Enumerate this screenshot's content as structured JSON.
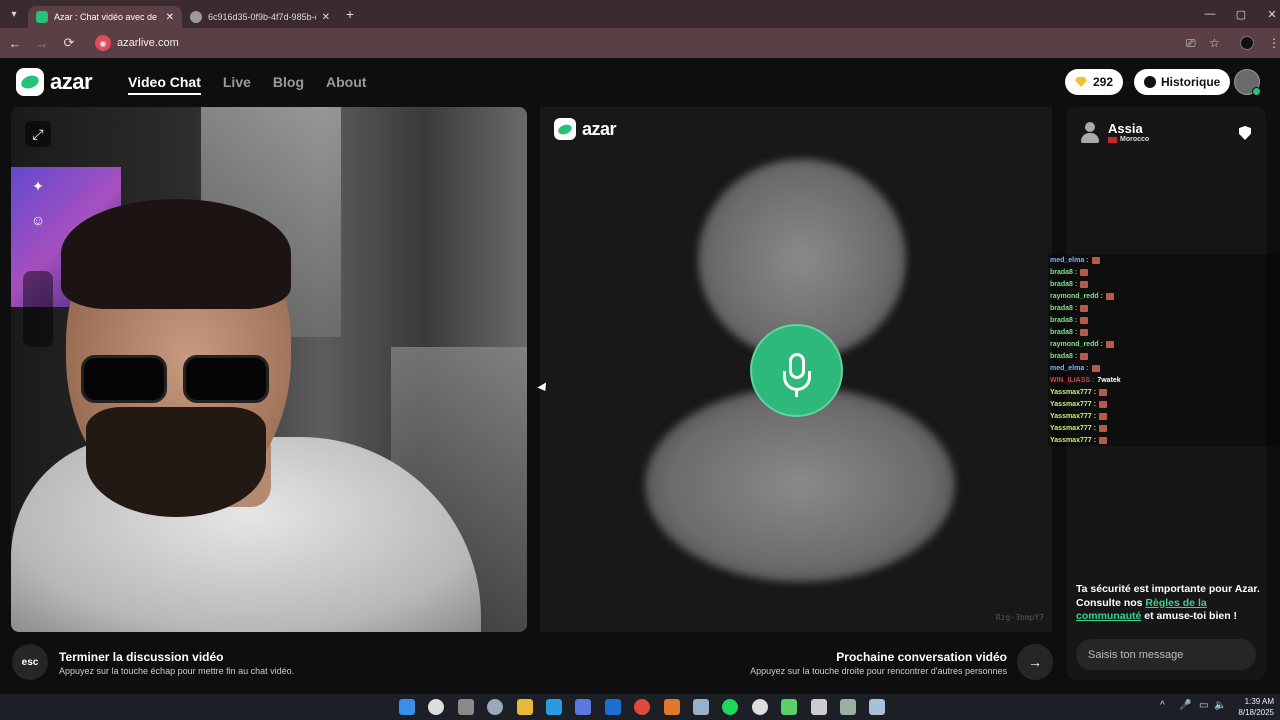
{
  "browser": {
    "tabs": [
      {
        "title": "Azar : Chat vidéo avec de n",
        "active": true,
        "favicon_color": "#27c27a"
      },
      {
        "title": "6c916d35-0f9b-4f7d-985b-c4b",
        "active": false,
        "favicon_color": "#9a9a9a"
      }
    ],
    "url": "azarlive.com",
    "icons": {
      "tab_search": "chevron-down-icon",
      "new_tab": "+",
      "back": "←",
      "forward": "→",
      "reload": "⟳",
      "minimize": "—",
      "maximize": "▢",
      "close": "✕",
      "tab_close": "✕"
    }
  },
  "site": {
    "logo_text": "azar",
    "nav": [
      {
        "label": "Video Chat",
        "active": true
      },
      {
        "label": "Live",
        "active": false
      },
      {
        "label": "Blog",
        "active": false
      },
      {
        "label": "About",
        "active": false
      }
    ],
    "gems": "292",
    "history_label": "Historique",
    "accent": "#27c27a"
  },
  "partner": {
    "logo_text": "azar",
    "name": "Assia",
    "country": "Morocco",
    "id": "Rzg-3bmpY7"
  },
  "feed": [
    {
      "user": "med_elma :",
      "color": "#7fb0ff",
      "text": ""
    },
    {
      "user": "brada8 :",
      "color": "#7fe08a",
      "text": ""
    },
    {
      "user": "brada8 :",
      "color": "#7fe08a",
      "text": ""
    },
    {
      "user": "raymond_redd :",
      "color": "#7fe08a",
      "text": ""
    },
    {
      "user": "brada8 :",
      "color": "#7fe08a",
      "text": ""
    },
    {
      "user": "brada8 :",
      "color": "#7fe08a",
      "text": ""
    },
    {
      "user": "brada8 :",
      "color": "#7fe08a",
      "text": ""
    },
    {
      "user": "raymond_redd :",
      "color": "#7fe08a",
      "text": ""
    },
    {
      "user": "brada8 :",
      "color": "#7fe08a",
      "text": ""
    },
    {
      "user": "med_elma :",
      "color": "#7fb0ff",
      "text": ""
    },
    {
      "user": "WIN_ILIASS :",
      "color": "#e04040",
      "text": "7watek"
    },
    {
      "user": "Yassmax777 :",
      "color": "#c6f07a",
      "text": ""
    },
    {
      "user": "Yassmax777 :",
      "color": "#c6f07a",
      "text": ""
    },
    {
      "user": "Yassmax777 :",
      "color": "#c6f07a",
      "text": ""
    },
    {
      "user": "Yassmax777 :",
      "color": "#c6f07a",
      "text": ""
    },
    {
      "user": "Yassmax777 :",
      "color": "#c6f07a",
      "text": ""
    }
  ],
  "safety": {
    "before": "Ta sécurité est importante pour Azar. Consulte nos ",
    "link": "Règles de la communauté",
    "after": " et amuse-toi bien !"
  },
  "chat_input": {
    "placeholder": "Saisis ton message"
  },
  "controls": {
    "end": {
      "key": "esc",
      "title": "Terminer la discussion vidéo",
      "sub": "Appuyez sur la touche échap pour mettre fin au chat vidéo."
    },
    "next": {
      "key": "→",
      "title": "Prochaine conversation vidéo",
      "sub": "Appuyez sur la touche droite pour rencontrer d'autres personnes"
    }
  },
  "taskbar": {
    "time": "1:39 AM",
    "date": "8/18/2025",
    "apps": [
      "windows-start-icon",
      "search-icon",
      "task-view-icon",
      "settings-icon",
      "file-explorer-icon",
      "edge-icon",
      "store-icon",
      "outlook-icon",
      "chrome-icon",
      "app-a-icon",
      "steam-icon",
      "spotify-icon",
      "obs-icon",
      "app-green-icon",
      "app-box-icon",
      "terminal-icon",
      "calculator-icon"
    ]
  }
}
